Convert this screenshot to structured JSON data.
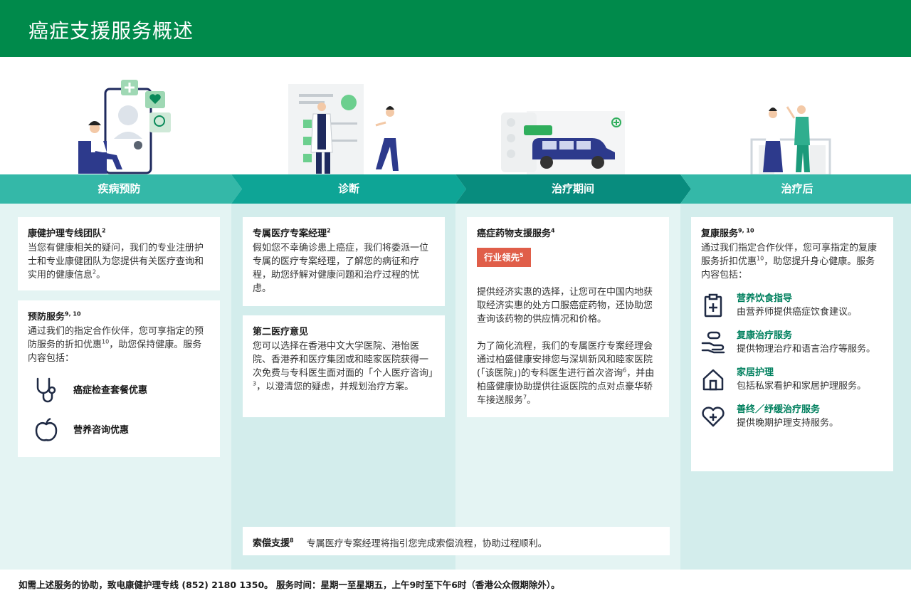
{
  "header": {
    "title": "癌症支援服务概述"
  },
  "stages": [
    {
      "label": "疾病预防"
    },
    {
      "label": "诊断"
    },
    {
      "label": "治疗期间"
    },
    {
      "label": "治疗后"
    }
  ],
  "colors": {
    "header": "#008a4b",
    "stage1": "#34b8a8",
    "stage2": "#0ea596",
    "stage3": "#088c7e",
    "stage4": "#34b8a8",
    "col_light": "#e4f4f3",
    "col_mid": "#d3edec",
    "badge": "#e05e49",
    "accent_text": "#00805e"
  },
  "prevention": {
    "hotline": {
      "title": "康健护理专线团队",
      "title_sup": "2",
      "body": "当您有健康相关的疑问，我们的专业注册护士和专业康健团队为您提供有关医疗查询和实用的健康信息",
      "body_sup": "2",
      "body_end": "。"
    },
    "preventive": {
      "title": "预防服务",
      "title_sup": "9, 10",
      "body_1": "通过我们的指定合作伙伴，您可享指定的预防服务的折扣优惠",
      "body_sup": "10",
      "body_2": "，助您保持健康。服务内容包括：",
      "services": [
        {
          "label": "癌症检查套餐优惠",
          "icon": "stethoscope-icon"
        },
        {
          "label": "营养咨询优惠",
          "icon": "apple-icon"
        }
      ]
    }
  },
  "diagnosis": {
    "case_manager": {
      "title": "专属医疗专案经理",
      "title_sup": "2",
      "body": "假如您不幸确诊患上癌症，我们将委派一位专属的医疗专案经理，了解您的病征和疗程，助您纾解对健康问题和治疗过程的忧虑。"
    },
    "second_opinion": {
      "title": "第二医疗意见",
      "body_1": "您可以选择在香港中文大学医院、港怡医院、香港养和医疗集团或和睦家医院获得一次免费与专科医生面对面的「个人医疗咨询」",
      "body_sup": "3",
      "body_2": "，以澄清您的疑虑，并规划治疗方案。"
    }
  },
  "treatment": {
    "drug_support": {
      "title": "癌症药物支援服务",
      "title_sup": "4",
      "badge": "行业领先",
      "badge_sup": "5",
      "para_1": "提供经济实惠的选择，让您可在中国内地获取经济实惠的处方口服癌症药物，还协助您查询该药物的供应情况和价格。",
      "para_2_a": "为了简化流程，我们的专属医疗专案经理会通过柏盛健康安排您与深圳新风和睦家医院(「该医院」)的专科医生进行首次咨询",
      "para_2_sup_a": "6",
      "para_2_b": "，并由柏盛健康协助提供往返医院的点对点豪华轿车接送服务",
      "para_2_sup_b": "7",
      "para_2_c": "。"
    }
  },
  "after": {
    "rehab": {
      "title": "复康服务",
      "title_sup": "9, 10",
      "body_1": "通过我们指定合作伙伴，您可享指定的复康服务折扣优惠",
      "body_sup": "10",
      "body_2": "，助您提升身心健康。服务内容包括：",
      "items": [
        {
          "title": "营养饮食指导",
          "desc": "由营养师提供癌症饮食建议。",
          "icon": "clipboard-icon"
        },
        {
          "title": "复康治疗服务",
          "desc": "提供物理治疗和语言治疗等服务。",
          "icon": "rehab-hand-icon"
        },
        {
          "title": "家居护理",
          "desc": "包括私家看护和家居护理服务。",
          "icon": "home-icon"
        },
        {
          "title": "善终／纾缓治疗服务",
          "desc": "提供晚期护理支持服务。",
          "icon": "heart-plus-icon"
        }
      ]
    }
  },
  "claim": {
    "title": "索偿支援",
    "title_sup": "8",
    "body": "专属医疗专案经理将指引您完成索偿流程，协助过程顺利。"
  },
  "footer": {
    "text": "如需上述服务的协助，致电康健护理专线 (852) 2180 1350。 服务时间：星期一至星期五，上午9时至下午6时（香港公众假期除外）。"
  }
}
